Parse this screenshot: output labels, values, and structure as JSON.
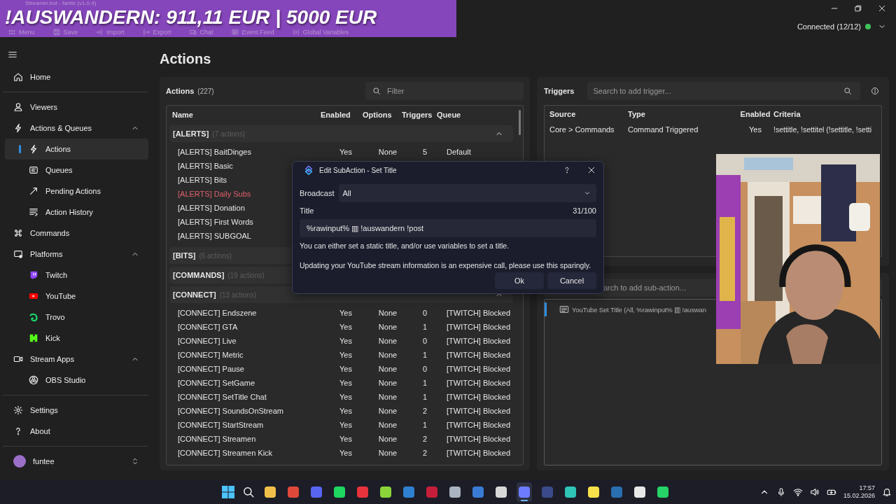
{
  "top_bar": {
    "window_title": "Streamer.bot - fantis (v1.0.4)",
    "overlay_text": "!AUSWANDERN: 911,11 EUR | 5000 EUR",
    "toolbar": [
      "Menu",
      "Save",
      "Import",
      "Export",
      "Chat",
      "Event Feed",
      "Global Variables"
    ],
    "connection": "Connected (12/12)",
    "connected": true
  },
  "sidebar": {
    "items": [
      {
        "label": "Home",
        "selected": false
      },
      {
        "label": "Viewers",
        "selected": false
      },
      {
        "label": "Actions & Queues",
        "selected": false,
        "expanded": true,
        "children": [
          {
            "label": "Actions",
            "selected": true
          },
          {
            "label": "Queues",
            "selected": false
          },
          {
            "label": "Pending Actions",
            "selected": false
          },
          {
            "label": "Action History",
            "selected": false
          }
        ]
      },
      {
        "label": "Commands",
        "selected": false
      },
      {
        "label": "Platforms",
        "selected": false,
        "expanded": true,
        "children": [
          {
            "label": "Twitch",
            "selected": false
          },
          {
            "label": "YouTube",
            "selected": false
          },
          {
            "label": "Trovo",
            "selected": false
          },
          {
            "label": "Kick",
            "selected": false
          }
        ]
      },
      {
        "label": "Stream Apps",
        "selected": false,
        "expanded": true,
        "children": [
          {
            "label": "OBS Studio",
            "selected": false
          }
        ]
      }
    ],
    "footer_items": [
      {
        "label": "Settings",
        "selected": false
      },
      {
        "label": "About",
        "selected": false
      }
    ],
    "user": {
      "name": "funtee"
    }
  },
  "page_title": "Actions",
  "actions_panel": {
    "title": "Actions",
    "count": "(227)",
    "filter": {
      "placeholder": "Filter"
    },
    "columns": [
      "Name",
      "Enabled",
      "Options",
      "Triggers",
      "Queue"
    ],
    "groups": [
      {
        "name": "[ALERTS]",
        "count": "(7 actions)",
        "expanded": true,
        "rows": [
          {
            "name": "[ALERTS] BaitDinges",
            "disabled": false,
            "enabled": "Yes",
            "options": "None",
            "triggers": "5",
            "queue": "Default"
          },
          {
            "name": "[ALERTS] Basic",
            "disabled": false
          },
          {
            "name": "[ALERTS] Bits",
            "disabled": false
          },
          {
            "name": "[ALERTS] Daily Subs",
            "disabled": true
          },
          {
            "name": "[ALERTS] Donation",
            "disabled": false
          },
          {
            "name": "[ALERTS] First Words",
            "disabled": false
          },
          {
            "name": "[ALERTS] SUBGOAL",
            "disabled": false
          }
        ]
      },
      {
        "name": "[BITS]",
        "count": "(6 actions)",
        "expanded": false
      },
      {
        "name": "[COMMANDS]",
        "count": "(19 actions)",
        "expanded": false
      },
      {
        "name": "[CONNECT]",
        "count": "(13 actions)",
        "expanded": true,
        "rows": [
          {
            "name": "[CONNECT] Endszene",
            "disabled": false,
            "enabled": "Yes",
            "options": "None",
            "triggers": "0",
            "queue": "[TWITCH] Blocked"
          },
          {
            "name": "[CONNECT] GTA",
            "disabled": false,
            "enabled": "Yes",
            "options": "None",
            "triggers": "1",
            "queue": "[TWITCH] Blocked"
          },
          {
            "name": "[CONNECT] Live",
            "disabled": false,
            "enabled": "Yes",
            "options": "None",
            "triggers": "0",
            "queue": "[TWITCH] Blocked"
          },
          {
            "name": "[CONNECT] Metric",
            "disabled": false,
            "enabled": "Yes",
            "options": "None",
            "triggers": "1",
            "queue": "[TWITCH] Blocked"
          },
          {
            "name": "[CONNECT] Pause",
            "disabled": false,
            "enabled": "Yes",
            "options": "None",
            "triggers": "0",
            "queue": "[TWITCH] Blocked"
          },
          {
            "name": "[CONNECT] SetGame",
            "disabled": false,
            "enabled": "Yes",
            "options": "None",
            "triggers": "1",
            "queue": "[TWITCH] Blocked"
          },
          {
            "name": "[CONNECT] SetTitle Chat",
            "disabled": false,
            "enabled": "Yes",
            "options": "None",
            "triggers": "1",
            "queue": "[TWITCH] Blocked"
          },
          {
            "name": "[CONNECT] SoundsOnStream",
            "disabled": false,
            "enabled": "Yes",
            "options": "None",
            "triggers": "2",
            "queue": "[TWITCH] Blocked"
          },
          {
            "name": "[CONNECT] StartStream",
            "disabled": false,
            "enabled": "Yes",
            "options": "None",
            "triggers": "1",
            "queue": "[TWITCH] Blocked"
          },
          {
            "name": "[CONNECT] Streamen",
            "disabled": false,
            "enabled": "Yes",
            "options": "None",
            "triggers": "2",
            "queue": "[TWITCH] Blocked"
          },
          {
            "name": "[CONNECT] Streamen Kick",
            "disabled": false,
            "enabled": "Yes",
            "options": "None",
            "triggers": "2",
            "queue": "[TWITCH] Blocked"
          }
        ]
      }
    ]
  },
  "triggers_panel": {
    "title": "Triggers",
    "search": {
      "placeholder": "Search to add trigger..."
    },
    "columns": [
      "Source",
      "Type",
      "Enabled",
      "Criteria"
    ],
    "rows": [
      {
        "source": "Core > Commands",
        "type": "Command Triggered",
        "enabled": "Yes",
        "criteria": "!settitle, !settitel (!settitle, !setti"
      }
    ]
  },
  "subactions_panel": {
    "search": {
      "placeholder": "arch to add sub-action..."
    },
    "rows": [
      {
        "text": "YouTube Set Title (All, %rawinput% ▥ !auswan",
        "selected": true
      }
    ]
  },
  "dialog": {
    "title": "Edit SubAction - Set Title",
    "broadcast_label": "Broadcast",
    "broadcast_value": "All",
    "title_label": "Title",
    "counter": "31/100",
    "title_value": "%rawinput% ▥ !auswandern !post",
    "hint": "You can either set a static title, and/or use variables to set a title.",
    "warning": "Updating your YouTube stream information is an expensive call, please use this sparingly.",
    "buttons": [
      "Ok",
      "Cancel"
    ]
  },
  "taskbar": {
    "apps": [
      {
        "color": "#f2c04a",
        "selected": false
      },
      {
        "color": "#e0483a",
        "selected": false
      },
      {
        "color": "#5865f2",
        "selected": false
      },
      {
        "color": "#1ed760",
        "selected": false
      },
      {
        "color": "#e8323c",
        "selected": false
      },
      {
        "color": "#8ad43a",
        "selected": false
      },
      {
        "color": "#2f80d1",
        "selected": false
      },
      {
        "color": "#c41e3a",
        "selected": false
      },
      {
        "color": "#aab4c0",
        "selected": false
      },
      {
        "color": "#3a7bd5",
        "selected": false
      },
      {
        "color": "#d8d8d8",
        "selected": false
      },
      {
        "color": "#6d7cff",
        "selected": true
      },
      {
        "color": "#3a4a8a",
        "selected": false
      },
      {
        "color": "#2ec4b6",
        "selected": false
      },
      {
        "color": "#f7e14a",
        "selected": false
      },
      {
        "color": "#2a6fb0",
        "selected": false
      },
      {
        "color": "#e8e8e8",
        "selected": false
      },
      {
        "color": "#25d366",
        "selected": false
      }
    ],
    "time": "17:57",
    "date": "15.02.2026"
  }
}
